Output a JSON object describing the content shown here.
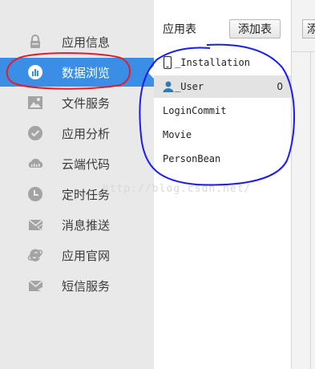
{
  "sidebar": {
    "items": [
      {
        "label": "应用信息",
        "icon": "lock-icon"
      },
      {
        "label": "数据浏览",
        "icon": "bar-chart-icon",
        "active": true
      },
      {
        "label": "文件服务",
        "icon": "image-icon"
      },
      {
        "label": "应用分析",
        "icon": "check-circle-icon"
      },
      {
        "label": "云端代码",
        "icon": "cloud-code-icon"
      },
      {
        "label": "定时任务",
        "icon": "clock-icon"
      },
      {
        "label": "消息推送",
        "icon": "send-mail-icon"
      },
      {
        "label": "应用官网",
        "icon": "ie-logo-icon"
      },
      {
        "label": "短信服务",
        "icon": "sms-mail-icon"
      }
    ]
  },
  "class_panel": {
    "title": "应用表",
    "add_button_label": "添加表",
    "classes": [
      {
        "name": "_Installation",
        "icon": "phone-icon"
      },
      {
        "name": "_User",
        "icon": "user-icon",
        "count": "0",
        "selected": true
      },
      {
        "name": "LoginCommit"
      },
      {
        "name": "Movie"
      },
      {
        "name": "PersonBean"
      }
    ]
  },
  "right_panel": {
    "button_label": "添"
  },
  "watermark": "http://blog.csdn.net/",
  "colors": {
    "active_bg": "#3a8ee6",
    "sidebar_bg": "#e9e9e9",
    "annotation_red": "#e8192c",
    "annotation_blue": "#1a1aff"
  }
}
